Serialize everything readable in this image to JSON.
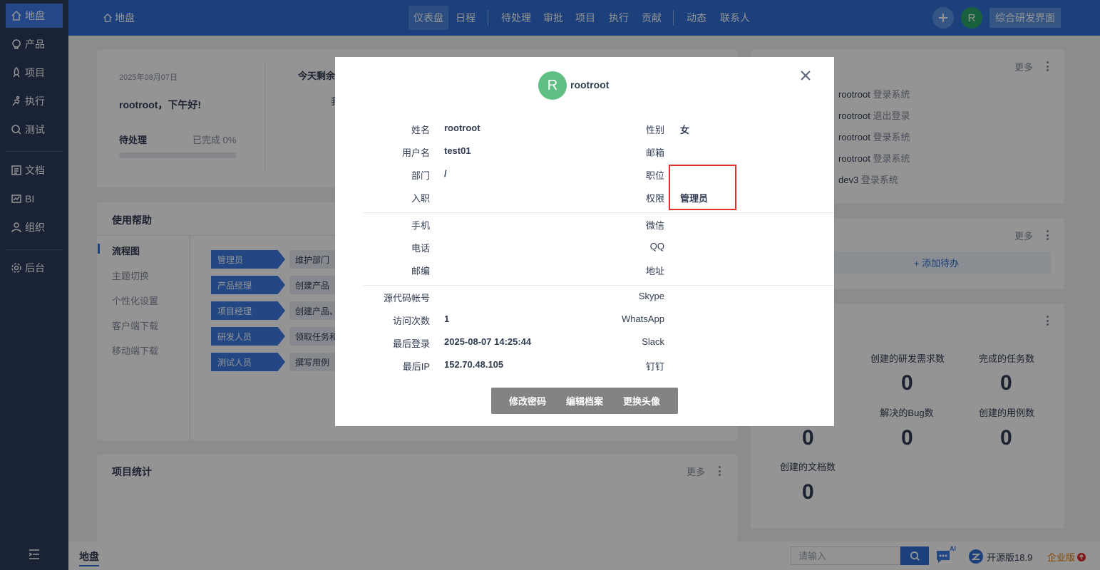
{
  "sidebar": {
    "items": [
      {
        "label": "地盘",
        "icon": "home-icon"
      },
      {
        "label": "产品",
        "icon": "lightbulb-icon"
      },
      {
        "label": "项目",
        "icon": "rocket-icon"
      },
      {
        "label": "执行",
        "icon": "run-icon"
      },
      {
        "label": "测试",
        "icon": "magnifier-icon"
      },
      {
        "label": "文档",
        "icon": "document-icon"
      },
      {
        "label": "BI",
        "icon": "chart-icon"
      },
      {
        "label": "组织",
        "icon": "user-icon"
      },
      {
        "label": "后台",
        "icon": "gear-icon"
      }
    ]
  },
  "header": {
    "breadcrumb": "地盘",
    "tabs": [
      "仪表盘",
      "日程",
      "待处理",
      "审批",
      "项目",
      "执行",
      "贡献",
      "动态",
      "联系人"
    ],
    "avatar_initial": "R",
    "switch_label": "综合研发界面"
  },
  "welcome": {
    "date": "2025年08月07日",
    "greeting": "rootroot，下午好!",
    "todo_label": "待处理",
    "done_label": "已完成 0%",
    "remaining_label": "今天剩余",
    "remaining_sub": "我"
  },
  "help": {
    "title": "使用帮助",
    "menu": [
      "流程图",
      "主题切换",
      "个性化设置",
      "客户端下载",
      "移动端下载"
    ],
    "flow": [
      {
        "role": "管理员",
        "desc": "维护部门"
      },
      {
        "role": "产品经理",
        "desc": "创建产品"
      },
      {
        "role": "项目经理",
        "desc": "创建产品、"
      },
      {
        "role": "研发人员",
        "desc": "领取任务和"
      },
      {
        "role": "测试人员",
        "desc": "撰写用例"
      }
    ]
  },
  "project_stats": {
    "title": "项目统计",
    "more": "更多"
  },
  "dynamics": {
    "more": "更多",
    "items": [
      {
        "user": "rootroot",
        "action": "登录系统"
      },
      {
        "user": "rootroot",
        "action": "退出登录"
      },
      {
        "user": "rootroot",
        "action": "登录系统"
      },
      {
        "user": "rootroot",
        "action": "登录系统"
      },
      {
        "user": "dev3",
        "action": "登录系统"
      }
    ]
  },
  "todos": {
    "more": "更多",
    "add_label": "+ 添加待办"
  },
  "contribution": {
    "stats": [
      {
        "label": "创建的研发需求数",
        "value": "0"
      },
      {
        "label": "完成的任务数",
        "value": "0"
      },
      {
        "label": "解决的Bug数",
        "value": "0"
      },
      {
        "label": "创建的用例数",
        "value": "0"
      },
      {
        "label": "创建的文档数",
        "value": "0"
      }
    ],
    "partial_values": [
      "0"
    ]
  },
  "bottombar": {
    "app_tab": "地盘",
    "search_placeholder": "请输入",
    "ai_badge": "AI",
    "version": "开源版18.9",
    "edition": "企业版"
  },
  "profile": {
    "avatar_initial": "R",
    "username_display": "rootroot",
    "rows1": [
      {
        "label": "姓名",
        "value": "rootroot",
        "label2": "性别",
        "value2": "女"
      },
      {
        "label": "用户名",
        "value": "test01",
        "label2": "邮箱",
        "value2": ""
      },
      {
        "label": "部门",
        "value": "/",
        "label2": "职位",
        "value2": ""
      },
      {
        "label": "入职",
        "value": "",
        "label2": "权限",
        "value2": "管理员"
      }
    ],
    "rows2": [
      {
        "label": "手机",
        "value": "",
        "label2": "微信",
        "value2": ""
      },
      {
        "label": "电话",
        "value": "",
        "label2": "QQ",
        "value2": ""
      },
      {
        "label": "邮编",
        "value": "",
        "label2": "地址",
        "value2": ""
      }
    ],
    "rows3": [
      {
        "label": "源代码帐号",
        "value": "",
        "label2": "Skype",
        "value2": ""
      },
      {
        "label": "访问次数",
        "value": "1",
        "label2": "WhatsApp",
        "value2": ""
      },
      {
        "label": "最后登录",
        "value": "2025-08-07 14:25:44",
        "label2": "Slack",
        "value2": ""
      },
      {
        "label": "最后IP",
        "value": "152.70.48.105",
        "label2": "钉钉",
        "value2": ""
      }
    ],
    "buttons": [
      "修改密码",
      "编辑档案",
      "更换头像"
    ]
  }
}
